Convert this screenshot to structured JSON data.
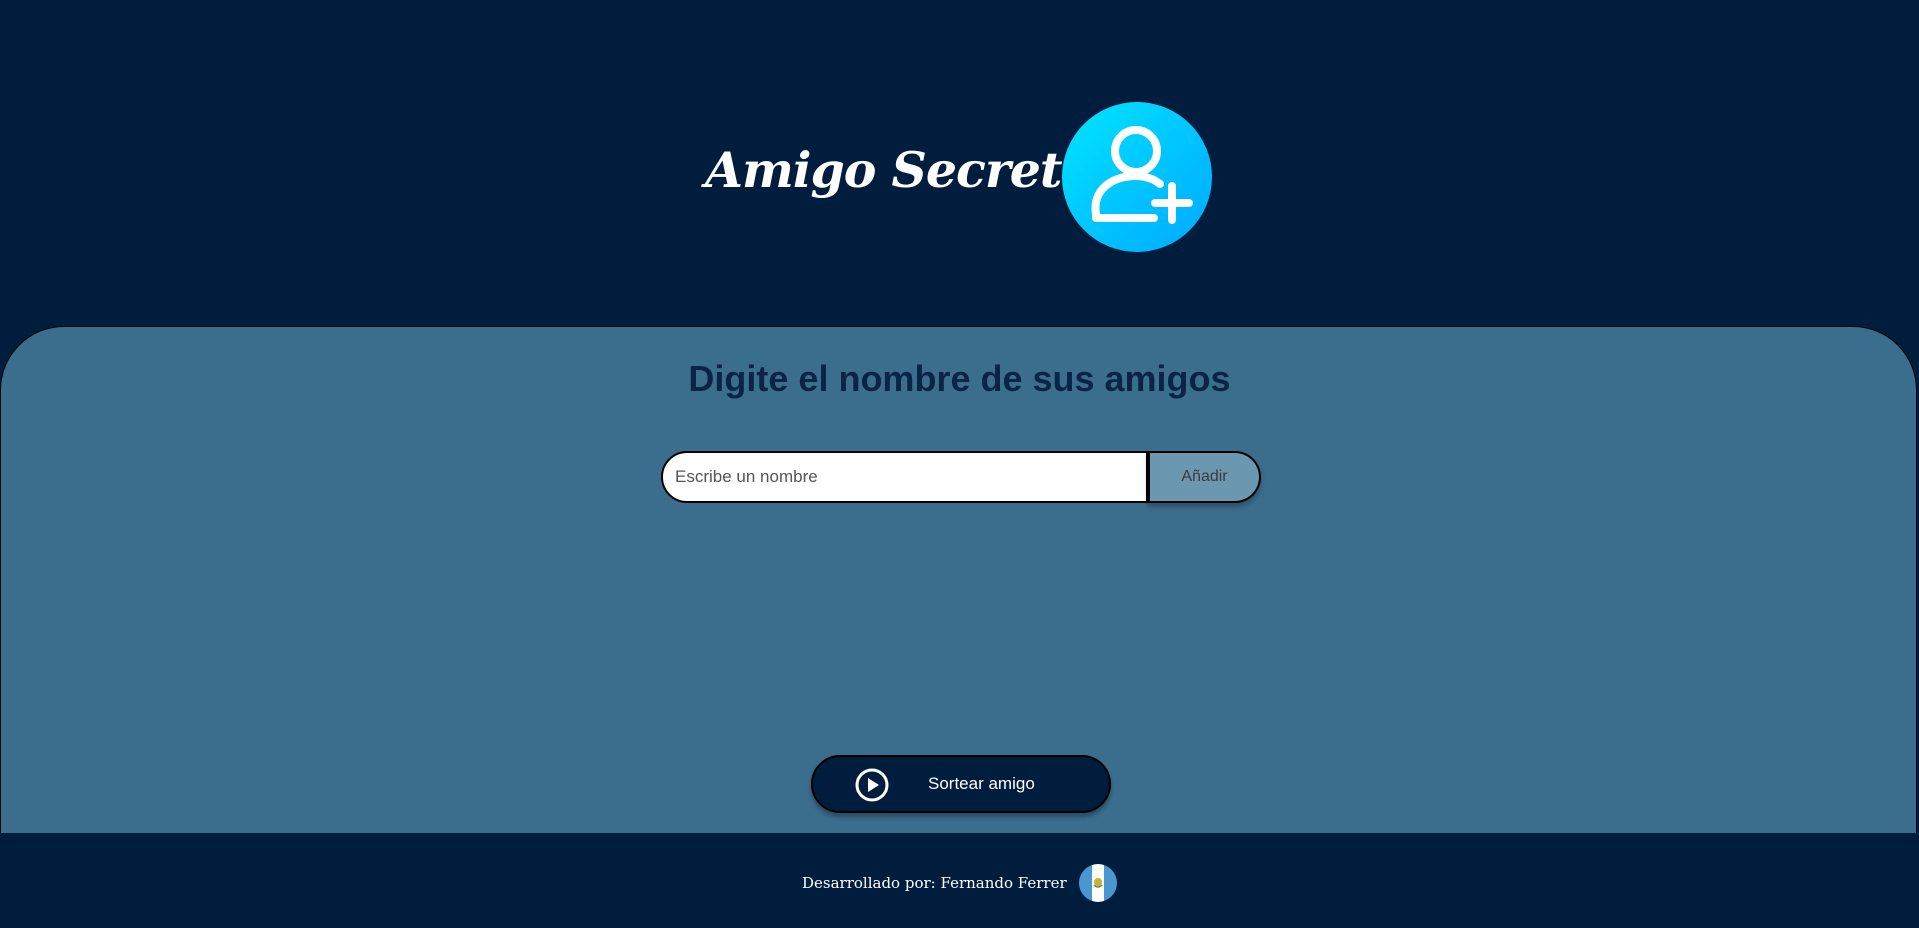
{
  "header": {
    "title": "Amigo Secreto",
    "logo_icon": "add-user-icon",
    "logo_gradient": [
      "#00e5ff",
      "#00a8ff"
    ]
  },
  "main": {
    "heading": "Digite el nombre de sus amigos",
    "input": {
      "placeholder": "Escribe un nombre",
      "value": ""
    },
    "add_button_label": "Añadir",
    "draw_button": {
      "label": "Sortear amigo",
      "icon": "play-circle-icon"
    }
  },
  "footer": {
    "credit": "Desarrollado por: Fernando Ferrer",
    "flag_icon": "guatemala-flag-icon"
  },
  "colors": {
    "background": "#011d3e",
    "panel": "#3b6d8c",
    "heading": "#0a2447",
    "add_button": "#6b98b0",
    "draw_button": "#011d3e"
  }
}
